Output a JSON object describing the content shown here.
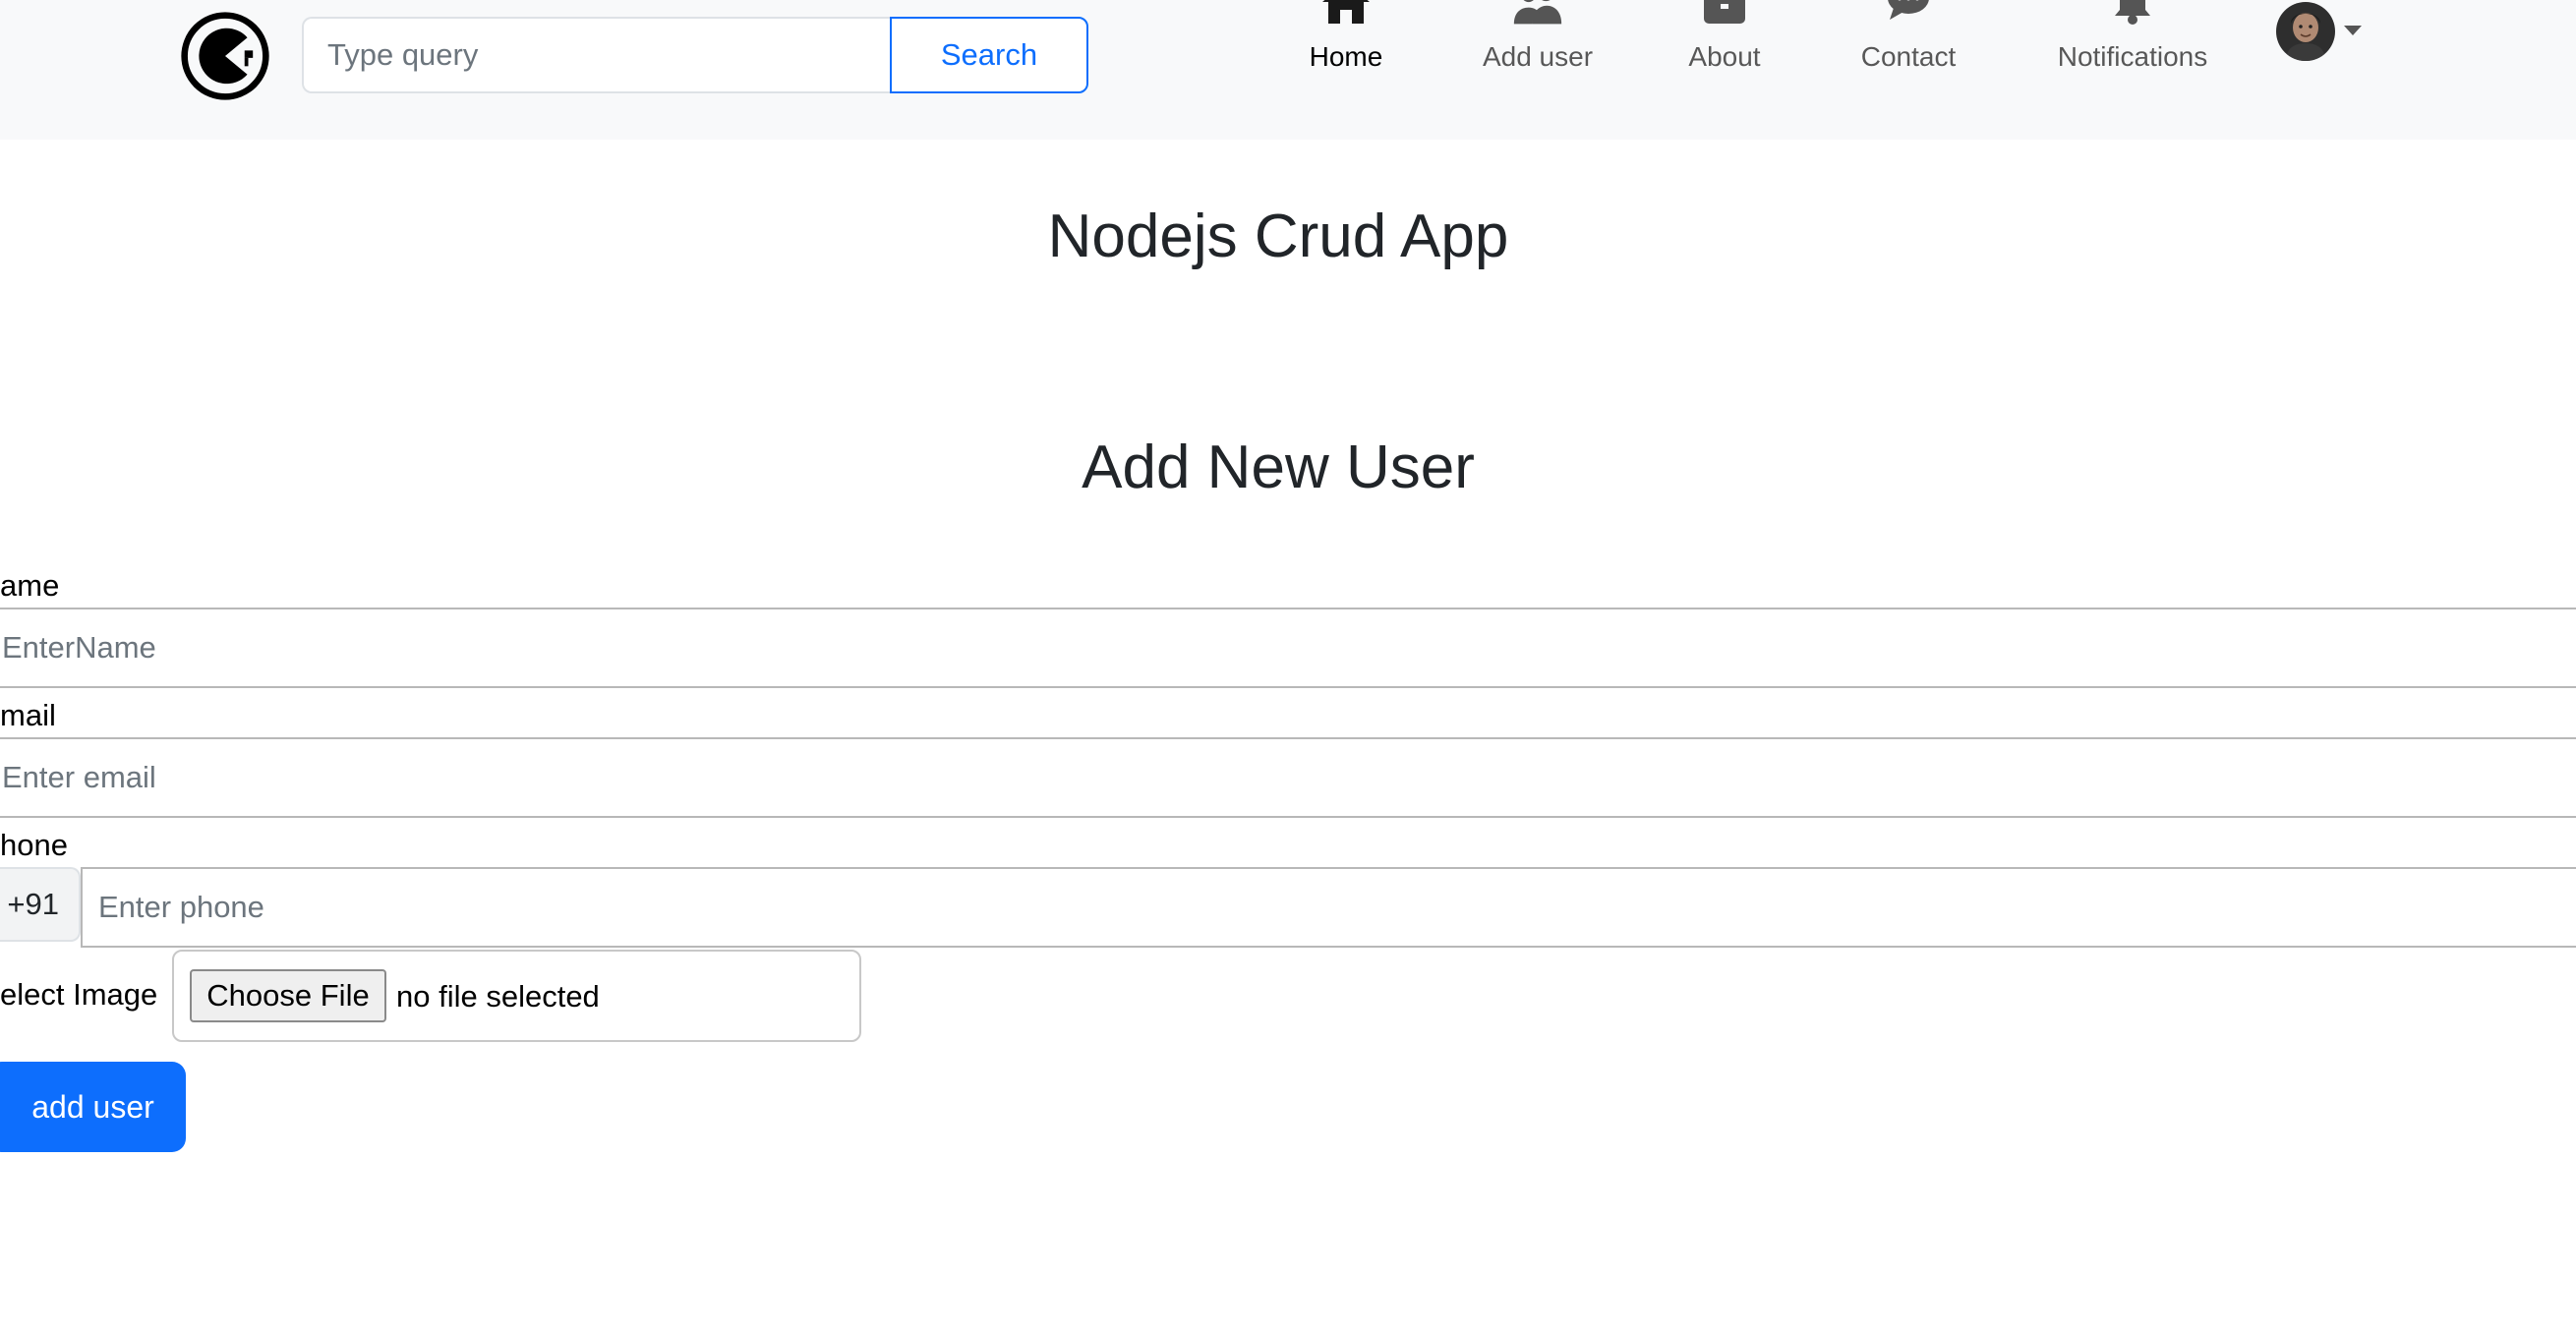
{
  "navbar": {
    "search": {
      "placeholder": "Type query",
      "button_label": "Search"
    },
    "items": [
      {
        "label": "Home",
        "icon": "home-icon",
        "active": true
      },
      {
        "label": "Add user",
        "icon": "users-icon",
        "active": false
      },
      {
        "label": "About",
        "icon": "briefcase-icon",
        "active": false
      },
      {
        "label": "Contact",
        "icon": "chat-icon",
        "active": false
      },
      {
        "label": "Notifications",
        "icon": "bell-icon",
        "active": false
      }
    ],
    "accent_color": "#0d6efd"
  },
  "main": {
    "app_title": "Nodejs Crud App",
    "form_title": "Add New User"
  },
  "form": {
    "name": {
      "label": "ame",
      "placeholder": "EnterName"
    },
    "email": {
      "label": "mail",
      "placeholder": "Enter email"
    },
    "phone": {
      "label": "hone",
      "prefix": "+91",
      "placeholder": "Enter phone"
    },
    "image": {
      "label": "elect Image",
      "button_label": "Choose File",
      "status": "no file selected"
    },
    "submit_label": "add user"
  }
}
